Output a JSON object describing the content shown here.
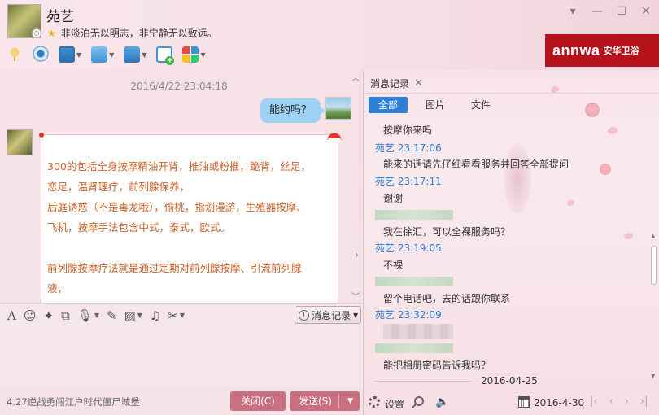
{
  "contact": {
    "name": "苑艺",
    "signature": "非淡泊无以明志，非宁静无以致远。"
  },
  "window_controls": [
    "▾",
    "—",
    "☐",
    "✕"
  ],
  "brand": {
    "logo_text": "annwa",
    "cn_text": "安华卫浴",
    "color": "#b5121b"
  },
  "chat": {
    "timestamp": "2016/4/22 23:04:18",
    "my_message": "能约吗？",
    "friend_message_lines": [
      "300的包括全身按摩精油开背，推油或粉推，跪背，丝足，",
      "恋足，温肾理疗，前列腺保养，",
      "后庭诱惑（不是毒龙哦），偷桃，指划漫游，生殖器按摩、",
      "飞机，按摩手法包含中式，泰式，欧式。",
      "",
      "前列腺按摩疗法就是通过定期对前列腺按摩、引流前列腺",
      "液，"
    ],
    "message_text_color": "#c9622a"
  },
  "input_toolbar": {
    "history_button": "消息记录"
  },
  "bottom": {
    "marquee": "4.27逆战勇闯江户时代僵尸城堡",
    "close_button": "关闭(C)",
    "send_button": "发送(S)"
  },
  "history_panel": {
    "tab_title": "消息记录",
    "subtabs": [
      "全部",
      "图片",
      "文件"
    ],
    "entries": {
      "m1": "按摩你来吗",
      "h1": "苑艺  23:17:06",
      "m2": "能来的话请先仔细看看服务并回答全部提问",
      "h2": "苑艺  23:17:11",
      "m3": "谢谢",
      "m4": "我在徐汇，可以全裸服务吗？",
      "h3": "苑艺  23:19:05",
      "m5": "不裸",
      "m6": "留个电话吧，去的话跟你联系",
      "h4": "苑艺  23:32:09",
      "m7": "能把相册密码告诉我吗？",
      "date_divider": "2016-04-25"
    },
    "footer": {
      "settings_label": "设置",
      "date_value": "2016-4-30"
    },
    "accent_color": "#2e7fd8"
  }
}
